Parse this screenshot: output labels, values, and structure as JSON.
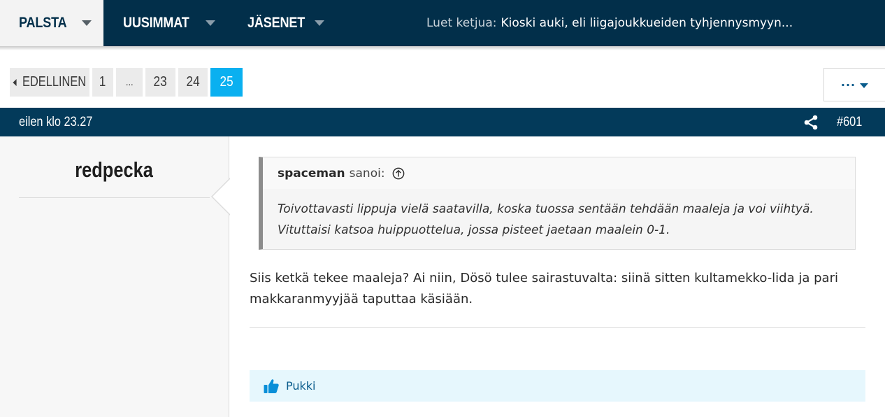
{
  "nav": {
    "tabs": [
      {
        "label": "PALSTA",
        "active": true
      },
      {
        "label": "UUSIMMAT",
        "active": false
      },
      {
        "label": "JÄSENET",
        "active": false
      }
    ],
    "reading_prefix": "Luet ketjua:",
    "thread_title": "Kioski auki, eli liigajoukkueiden tyhjennysmyyn..."
  },
  "pagination": {
    "prev_label": "EDELLINEN",
    "pages": [
      "1",
      "...",
      "23",
      "24",
      "25"
    ],
    "current": "25",
    "more_label": "···"
  },
  "post": {
    "time": "eilen klo 23.27",
    "number": "#601",
    "username": "redpecka",
    "quote": {
      "author": "spaceman",
      "said": "sanoi:",
      "lines": [
        "Toivottavasti lippuja vielä saatavilla, koska tuossa sentään tehdään maaleja ja voi viihtyä.",
        "Vituttaisi katsoa huippuottelua, jossa pisteet jaetaan maalein 0-1."
      ]
    },
    "message_lines": [
      "Siis ketkä tekee maaleja? Ai niin, Dösö tulee sairastuvalta: siinä sitten kultamekko-lida ja pari",
      "makkaranmyyjää taputtaa käsiään."
    ],
    "reaction_label": "Pukki"
  },
  "colors": {
    "nav_bg": "#022f4a",
    "post_bar": "#033a5a",
    "accent": "#0ab0f0",
    "link": "#0a5c8c"
  }
}
